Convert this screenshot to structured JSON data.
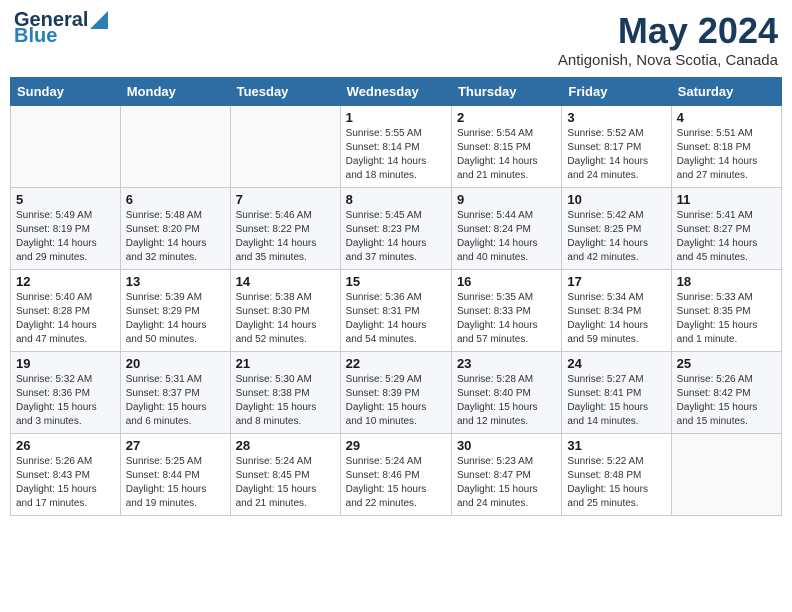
{
  "header": {
    "logo_general": "General",
    "logo_blue": "Blue",
    "title": "May 2024",
    "location": "Antigonish, Nova Scotia, Canada"
  },
  "days_of_week": [
    "Sunday",
    "Monday",
    "Tuesday",
    "Wednesday",
    "Thursday",
    "Friday",
    "Saturday"
  ],
  "weeks": [
    [
      {
        "day": "",
        "info": ""
      },
      {
        "day": "",
        "info": ""
      },
      {
        "day": "",
        "info": ""
      },
      {
        "day": "1",
        "info": "Sunrise: 5:55 AM\nSunset: 8:14 PM\nDaylight: 14 hours\nand 18 minutes."
      },
      {
        "day": "2",
        "info": "Sunrise: 5:54 AM\nSunset: 8:15 PM\nDaylight: 14 hours\nand 21 minutes."
      },
      {
        "day": "3",
        "info": "Sunrise: 5:52 AM\nSunset: 8:17 PM\nDaylight: 14 hours\nand 24 minutes."
      },
      {
        "day": "4",
        "info": "Sunrise: 5:51 AM\nSunset: 8:18 PM\nDaylight: 14 hours\nand 27 minutes."
      }
    ],
    [
      {
        "day": "5",
        "info": "Sunrise: 5:49 AM\nSunset: 8:19 PM\nDaylight: 14 hours\nand 29 minutes."
      },
      {
        "day": "6",
        "info": "Sunrise: 5:48 AM\nSunset: 8:20 PM\nDaylight: 14 hours\nand 32 minutes."
      },
      {
        "day": "7",
        "info": "Sunrise: 5:46 AM\nSunset: 8:22 PM\nDaylight: 14 hours\nand 35 minutes."
      },
      {
        "day": "8",
        "info": "Sunrise: 5:45 AM\nSunset: 8:23 PM\nDaylight: 14 hours\nand 37 minutes."
      },
      {
        "day": "9",
        "info": "Sunrise: 5:44 AM\nSunset: 8:24 PM\nDaylight: 14 hours\nand 40 minutes."
      },
      {
        "day": "10",
        "info": "Sunrise: 5:42 AM\nSunset: 8:25 PM\nDaylight: 14 hours\nand 42 minutes."
      },
      {
        "day": "11",
        "info": "Sunrise: 5:41 AM\nSunset: 8:27 PM\nDaylight: 14 hours\nand 45 minutes."
      }
    ],
    [
      {
        "day": "12",
        "info": "Sunrise: 5:40 AM\nSunset: 8:28 PM\nDaylight: 14 hours\nand 47 minutes."
      },
      {
        "day": "13",
        "info": "Sunrise: 5:39 AM\nSunset: 8:29 PM\nDaylight: 14 hours\nand 50 minutes."
      },
      {
        "day": "14",
        "info": "Sunrise: 5:38 AM\nSunset: 8:30 PM\nDaylight: 14 hours\nand 52 minutes."
      },
      {
        "day": "15",
        "info": "Sunrise: 5:36 AM\nSunset: 8:31 PM\nDaylight: 14 hours\nand 54 minutes."
      },
      {
        "day": "16",
        "info": "Sunrise: 5:35 AM\nSunset: 8:33 PM\nDaylight: 14 hours\nand 57 minutes."
      },
      {
        "day": "17",
        "info": "Sunrise: 5:34 AM\nSunset: 8:34 PM\nDaylight: 14 hours\nand 59 minutes."
      },
      {
        "day": "18",
        "info": "Sunrise: 5:33 AM\nSunset: 8:35 PM\nDaylight: 15 hours\nand 1 minute."
      }
    ],
    [
      {
        "day": "19",
        "info": "Sunrise: 5:32 AM\nSunset: 8:36 PM\nDaylight: 15 hours\nand 3 minutes."
      },
      {
        "day": "20",
        "info": "Sunrise: 5:31 AM\nSunset: 8:37 PM\nDaylight: 15 hours\nand 6 minutes."
      },
      {
        "day": "21",
        "info": "Sunrise: 5:30 AM\nSunset: 8:38 PM\nDaylight: 15 hours\nand 8 minutes."
      },
      {
        "day": "22",
        "info": "Sunrise: 5:29 AM\nSunset: 8:39 PM\nDaylight: 15 hours\nand 10 minutes."
      },
      {
        "day": "23",
        "info": "Sunrise: 5:28 AM\nSunset: 8:40 PM\nDaylight: 15 hours\nand 12 minutes."
      },
      {
        "day": "24",
        "info": "Sunrise: 5:27 AM\nSunset: 8:41 PM\nDaylight: 15 hours\nand 14 minutes."
      },
      {
        "day": "25",
        "info": "Sunrise: 5:26 AM\nSunset: 8:42 PM\nDaylight: 15 hours\nand 15 minutes."
      }
    ],
    [
      {
        "day": "26",
        "info": "Sunrise: 5:26 AM\nSunset: 8:43 PM\nDaylight: 15 hours\nand 17 minutes."
      },
      {
        "day": "27",
        "info": "Sunrise: 5:25 AM\nSunset: 8:44 PM\nDaylight: 15 hours\nand 19 minutes."
      },
      {
        "day": "28",
        "info": "Sunrise: 5:24 AM\nSunset: 8:45 PM\nDaylight: 15 hours\nand 21 minutes."
      },
      {
        "day": "29",
        "info": "Sunrise: 5:24 AM\nSunset: 8:46 PM\nDaylight: 15 hours\nand 22 minutes."
      },
      {
        "day": "30",
        "info": "Sunrise: 5:23 AM\nSunset: 8:47 PM\nDaylight: 15 hours\nand 24 minutes."
      },
      {
        "day": "31",
        "info": "Sunrise: 5:22 AM\nSunset: 8:48 PM\nDaylight: 15 hours\nand 25 minutes."
      },
      {
        "day": "",
        "info": ""
      }
    ]
  ]
}
